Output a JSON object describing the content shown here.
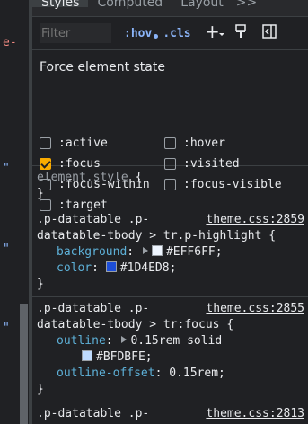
{
  "gutter": {
    "fragments": [
      "e-",
      "\"",
      "\"",
      "\""
    ]
  },
  "tabs": {
    "styles": "Styles",
    "computed": "Computed",
    "layout": "Layout",
    "more": ">>"
  },
  "filterbar": {
    "placeholder": "Filter",
    "hov": ":hov",
    "cls": ".cls"
  },
  "force_state": {
    "title": "Force element state",
    "options": [
      ":active",
      ":hover",
      ":focus",
      ":visited",
      ":focus-within",
      ":focus-visible",
      ":target"
    ],
    "checked": ":focus"
  },
  "rules": {
    "element_style": {
      "selector": "element.style",
      "open": "{",
      "close": "}"
    },
    "r1": {
      "selector_line1": ".p-datatable .p-",
      "selector_line2": "datatable-tbody > tr.p-highlight {",
      "source": "theme.css:2859",
      "props": [
        {
          "name": "background",
          "value": "#EFF6FF;"
        },
        {
          "name": "color",
          "value": "#1D4ED8;"
        }
      ],
      "close": "}"
    },
    "r2": {
      "selector_line1": ".p-datatable .p-",
      "selector_line2": "datatable-tbody > tr:focus {",
      "source": "theme.css:2855",
      "outline_name": "outline",
      "outline_value1": "0.15rem solid",
      "outline_value2": "#BFDBFE;",
      "offset_name": "outline-offset",
      "offset_value": "0.15rem;",
      "close": "}"
    },
    "r3": {
      "selector_line1": ".p-datatable .p-",
      "source": "theme.css:2813"
    }
  },
  "colors": {
    "swatch_bg": "#EFF6FF",
    "swatch_color": "#1D4ED8",
    "swatch_outline": "#BFDBFE",
    "accent": "#8ab4f8",
    "checkbox": "#f9ab00"
  }
}
